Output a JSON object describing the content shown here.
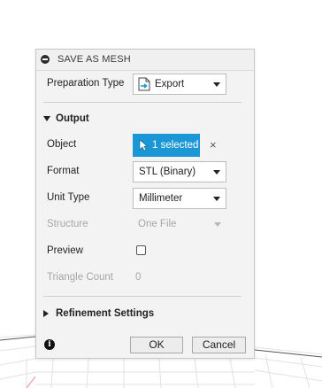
{
  "dialog": {
    "title": "SAVE AS MESH",
    "preparation_type": {
      "label": "Preparation Type",
      "value": "Export",
      "icon": "export-file-icon"
    },
    "output_section": {
      "title": "Output",
      "expanded": true
    },
    "object": {
      "label": "Object",
      "button_label": "1 selected",
      "clear_label": "×",
      "accent": "#1c97d6"
    },
    "format": {
      "label": "Format",
      "value": "STL (Binary)"
    },
    "unit_type": {
      "label": "Unit Type",
      "value": "Millimeter"
    },
    "structure": {
      "label": "Structure",
      "value": "One File",
      "disabled": true
    },
    "preview": {
      "label": "Preview",
      "checked": false
    },
    "triangle_count": {
      "label": "Triangle Count",
      "value": "0",
      "disabled": true
    },
    "refinement_section": {
      "title": "Refinement Settings",
      "expanded": false
    },
    "footer": {
      "info_icon": "info-icon",
      "info_glyph": "i",
      "ok_label": "OK",
      "cancel_label": "Cancel"
    }
  }
}
